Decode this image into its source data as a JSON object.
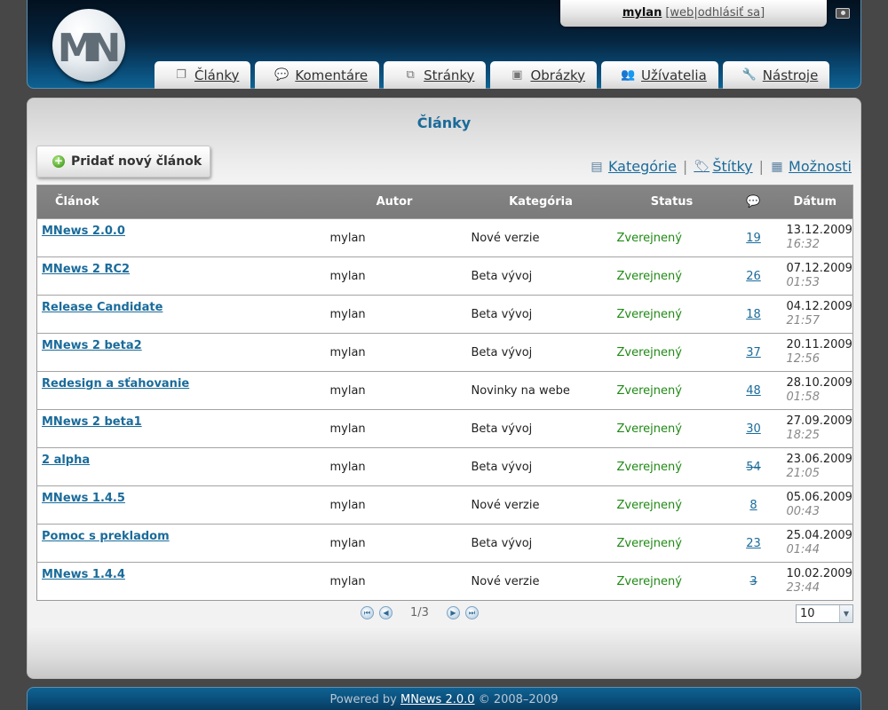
{
  "header": {
    "logo_text": "MN",
    "user": {
      "name": "mylan",
      "web_label": "web",
      "logout_label": "odhlásiť sa"
    }
  },
  "tabs": [
    {
      "label": "Články",
      "icon": "copy-icon"
    },
    {
      "label": "Komentáre",
      "icon": "speech-bubble-icon"
    },
    {
      "label": "Stránky",
      "icon": "window-icon"
    },
    {
      "label": "Obrázky",
      "icon": "images-icon"
    },
    {
      "label": "Užívatelia",
      "icon": "users-icon"
    },
    {
      "label": "Nástroje",
      "icon": "wrench-icon"
    }
  ],
  "main": {
    "title": "Články",
    "add_button": "Pridať nový článok",
    "links": {
      "categories": "Kategórie",
      "tags": "Štítky",
      "options": "Možnosti"
    },
    "columns": {
      "article": "Článok",
      "author": "Autor",
      "category": "Kategória",
      "status": "Status",
      "date": "Dátum"
    },
    "rows": [
      {
        "title": "MNews 2.0.0",
        "author": "mylan",
        "category": "Nové verzie",
        "status": "Zverejnený",
        "comments": "19",
        "strike": false,
        "date": "13.12.2009",
        "time": "16:32"
      },
      {
        "title": "MNews 2 RC2",
        "author": "mylan",
        "category": "Beta vývoj",
        "status": "Zverejnený",
        "comments": "26",
        "strike": false,
        "date": "07.12.2009",
        "time": "01:53"
      },
      {
        "title": "Release Candidate",
        "author": "mylan",
        "category": "Beta vývoj",
        "status": "Zverejnený",
        "comments": "18",
        "strike": false,
        "date": "04.12.2009",
        "time": "21:57"
      },
      {
        "title": "MNews 2 beta2",
        "author": "mylan",
        "category": "Beta vývoj",
        "status": "Zverejnený",
        "comments": "37",
        "strike": false,
        "date": "20.11.2009",
        "time": "12:56"
      },
      {
        "title": "Redesign a sťahovanie",
        "author": "mylan",
        "category": "Novinky na webe",
        "status": "Zverejnený",
        "comments": "48",
        "strike": false,
        "date": "28.10.2009",
        "time": "01:58"
      },
      {
        "title": "MNews 2 beta1",
        "author": "mylan",
        "category": "Beta vývoj",
        "status": "Zverejnený",
        "comments": "30",
        "strike": false,
        "date": "27.09.2009",
        "time": "18:25"
      },
      {
        "title": "2 alpha",
        "author": "mylan",
        "category": "Beta vývoj",
        "status": "Zverejnený",
        "comments": "54",
        "strike": true,
        "date": "23.06.2009",
        "time": "21:05"
      },
      {
        "title": "MNews 1.4.5",
        "author": "mylan",
        "category": "Nové verzie",
        "status": "Zverejnený",
        "comments": "8",
        "strike": false,
        "date": "05.06.2009",
        "time": "00:43"
      },
      {
        "title": "Pomoc s prekladom",
        "author": "mylan",
        "category": "Beta vývoj",
        "status": "Zverejnený",
        "comments": "23",
        "strike": false,
        "date": "25.04.2009",
        "time": "01:44"
      },
      {
        "title": "MNews 1.4.4",
        "author": "mylan",
        "category": "Nové verzie",
        "status": "Zverejnený",
        "comments": "3",
        "strike": true,
        "date": "10.02.2009",
        "time": "23:44"
      }
    ],
    "pager": {
      "page": "1/3",
      "per_page": "10"
    }
  },
  "footer": {
    "prefix": "Powered by",
    "link": "MNews 2.0.0",
    "suffix": "© 2008–2009"
  },
  "colors": {
    "accent": "#1a6b9a",
    "published": "#1f8a14",
    "header_bg": "#05243e"
  }
}
